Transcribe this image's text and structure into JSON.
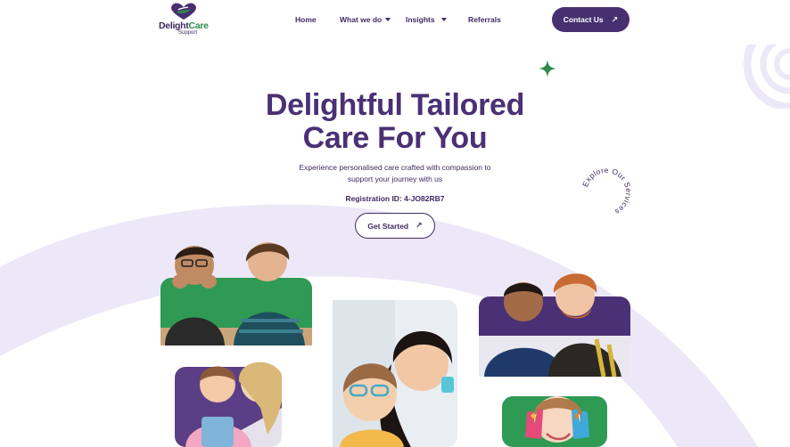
{
  "brand": {
    "name_main": "Delight",
    "name_accent": "Care",
    "name_sub": "Support",
    "colors": {
      "primary": "#46306f",
      "accent_green": "#2f8a4c",
      "lavender": "#ece8f8"
    }
  },
  "nav": {
    "items": [
      {
        "label": "Home",
        "has_dropdown": false
      },
      {
        "label": "What we do",
        "has_dropdown": true
      },
      {
        "label": "Insights",
        "has_dropdown": true
      },
      {
        "label": "Referrals",
        "has_dropdown": false
      }
    ],
    "contact": {
      "label": "Contact Us",
      "icon": "arrow-up-right-icon"
    }
  },
  "hero": {
    "title_line1": "Delightful Tailored",
    "title_line2": "Care For You",
    "subtitle_line1": "Experience personalised care crafted with compassion to",
    "subtitle_line2": "support your journey with us",
    "registration": "Registration ID: 4-JO82RB7",
    "cta": {
      "label": "Get Started",
      "icon": "arrow-up-right-icon"
    },
    "badge_text": "Explore Our Services"
  },
  "photos": [
    {
      "name": "photo-two-boys-smiling",
      "bg": "#2e9a54"
    },
    {
      "name": "photo-girl-and-mother",
      "bg": "#5b3f86"
    },
    {
      "name": "photo-girl-with-glasses",
      "bg": "#e9eef2"
    },
    {
      "name": "photo-two-men-laughing",
      "bg": "#4a3075"
    },
    {
      "name": "photo-child-painted-hands",
      "bg": "#2e9a54"
    }
  ],
  "decor": {
    "sparkle_icon": "sparkle-icon",
    "rings_icon": "rings-decoration"
  }
}
